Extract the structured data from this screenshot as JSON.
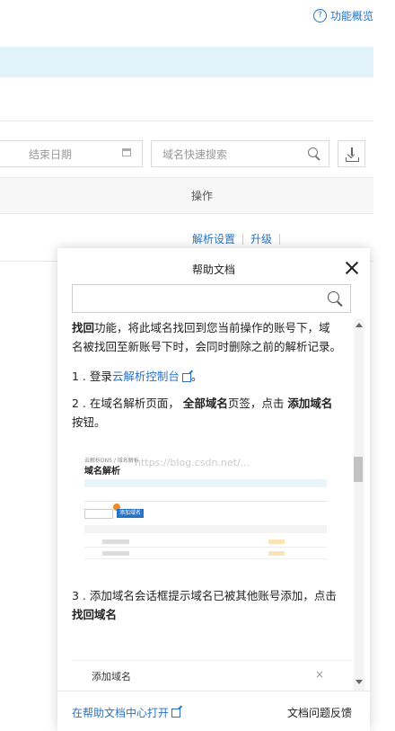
{
  "header": {
    "overview_link": "功能概览",
    "help_icon_glyph": "?"
  },
  "filters": {
    "end_date_placeholder": "结束日期",
    "domain_search_placeholder": "域名快速搜索"
  },
  "table": {
    "header_operation": "操作",
    "row_actions": [
      "解析设置",
      "升级"
    ]
  },
  "help_panel": {
    "title": "帮助文档",
    "search_value": "",
    "paragraph_1": {
      "bold": "找回",
      "text": "功能，将此域名找回到您当前操作的账号下，域名被找回至新账号下时，会同时删除之前的解析记录。"
    },
    "step_1": {
      "prefix": "1 . 登录",
      "link": "云解析控制台",
      "suffix": "。"
    },
    "step_2": {
      "prefix": "2 . 在域名解析页面，",
      "bold_1": "全部域名",
      "middle": "页签，点击",
      "bold_2": "添加域名",
      "suffix": "按钮。"
    },
    "screenshot": {
      "breadcrumb": "云解析DNS / 域名解析",
      "title": "域名解析",
      "button": "添加域名"
    },
    "step_3": {
      "prefix": "3 . 添加域名会话框提示域名已被其他账号添加，点击",
      "bold": "找回域名"
    },
    "sub_dialog": {
      "label": "添加域名",
      "close": "×"
    },
    "footer": {
      "open_link": "在帮助文档中心打开",
      "feedback": "文档问题反馈"
    }
  },
  "watermark": "https://blog.csdn.net/..."
}
